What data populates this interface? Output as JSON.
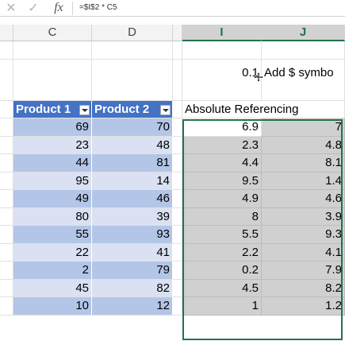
{
  "formula_bar": {
    "cancel_icon": "close-icon",
    "enter_icon": "checkmark-icon",
    "fx_label": "fx",
    "formula": "=$I$2 * C5"
  },
  "columns": [
    {
      "letter": "C",
      "selected": false
    },
    {
      "letter": "D",
      "selected": false
    },
    {
      "letter": "I",
      "selected": true
    },
    {
      "letter": "J",
      "selected": true
    }
  ],
  "rate_cell": {
    "value": "0.1",
    "note": "Add $ symbo"
  },
  "table": {
    "headers": [
      "Product 1",
      "Product 2"
    ],
    "absolute_header": "Absolute Referencing",
    "rows": [
      {
        "p1": "69",
        "p2": "70",
        "i": "6.9",
        "j": "7"
      },
      {
        "p1": "23",
        "p2": "48",
        "i": "2.3",
        "j": "4.8"
      },
      {
        "p1": "44",
        "p2": "81",
        "i": "4.4",
        "j": "8.1"
      },
      {
        "p1": "95",
        "p2": "14",
        "i": "9.5",
        "j": "1.4"
      },
      {
        "p1": "49",
        "p2": "46",
        "i": "4.9",
        "j": "4.6"
      },
      {
        "p1": "80",
        "p2": "39",
        "i": "8",
        "j": "3.9"
      },
      {
        "p1": "55",
        "p2": "93",
        "i": "5.5",
        "j": "9.3"
      },
      {
        "p1": "22",
        "p2": "41",
        "i": "2.2",
        "j": "4.1"
      },
      {
        "p1": "2",
        "p2": "79",
        "i": "0.2",
        "j": "7.9"
      },
      {
        "p1": "45",
        "p2": "82",
        "i": "4.5",
        "j": "8.2"
      },
      {
        "p1": "10",
        "p2": "12",
        "i": "1",
        "j": "1.2"
      }
    ]
  },
  "colors": {
    "header_fill": "#4472c4",
    "band_dark": "#b4c6e7",
    "band_light": "#d9e1f2",
    "selection_border": "#217346",
    "selection_fill": "#d0d0d0"
  }
}
